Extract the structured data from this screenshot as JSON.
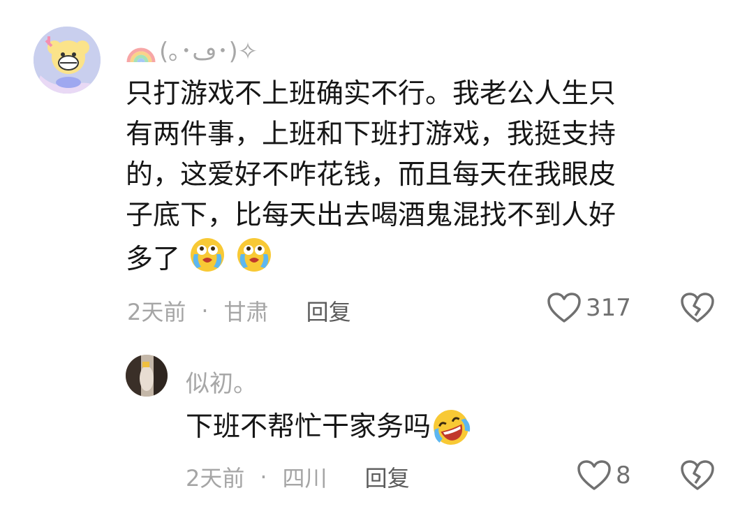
{
  "comments": [
    {
      "username": "(｡･ڡ･)✧",
      "content_lines": [
        "只打游戏不上班确实不行。我老公人生只",
        "有两件事，上班和下班打游戏，我挺支持",
        "的，这爱好不咋花钱，而且每天在我眼皮",
        "子底下，比每天出去喝酒鬼混找不到人好",
        "多了"
      ],
      "time": "2天前",
      "separator": "·",
      "location": "甘肃",
      "reply_label": "回复",
      "like_count": "317",
      "emojis": [
        "crying-emoji",
        "crying-emoji"
      ]
    },
    {
      "username": "似初。",
      "content": "下班不帮忙干家务吗",
      "time": "2天前",
      "separator": "·",
      "location": "四川",
      "reply_label": "回复",
      "like_count": "8",
      "emojis": [
        "laughing-crying-emoji"
      ]
    }
  ],
  "colors": {
    "text": "#161616",
    "secondary": "#a5a5a5",
    "reply": "#5b5b5b",
    "icon": "#707070"
  }
}
